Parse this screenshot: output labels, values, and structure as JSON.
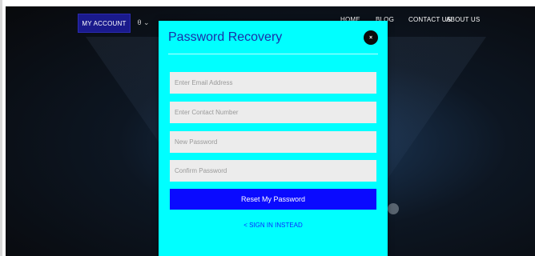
{
  "nav": {
    "my_account_label": "MY ACCOUNT",
    "user_menu_glyph": "θ ⌄",
    "links": [
      "HOME",
      "BLOG",
      "CONTACT US",
      "ABOUT US"
    ]
  },
  "modal": {
    "title": "Password Recovery",
    "close_glyph": "×",
    "fields": {
      "email_placeholder": "Enter Email Address",
      "contact_placeholder": "Enter Contact Number",
      "new_password_placeholder": "New Password",
      "confirm_password_placeholder": "Confirm Password"
    },
    "reset_label": "Reset My Password",
    "signin_label": "< SIGN IN INSTEAD"
  },
  "colors": {
    "modal_bg": "#00ffff",
    "reset_button": "#0a0aff",
    "account_button": "#1a1a8c",
    "title": "#1a2ea8"
  },
  "icons": {
    "close": "close-icon",
    "user_menu": "user-icon"
  }
}
